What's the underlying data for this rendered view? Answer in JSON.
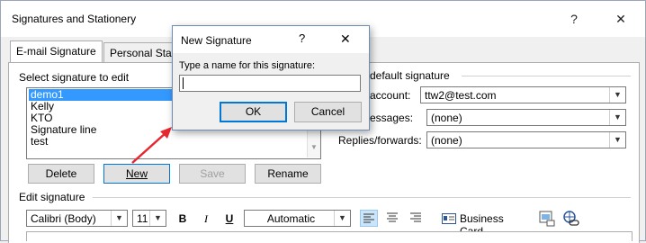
{
  "window": {
    "title": "Signatures and Stationery",
    "help": "?",
    "close": "✕",
    "tabs": [
      {
        "label": "E-mail Signature"
      },
      {
        "label": "Personal Stati"
      }
    ]
  },
  "select_section": {
    "label": "Select signature to edit",
    "items": [
      "demo1",
      "Kelly",
      "KTO",
      "Signature line",
      "test"
    ],
    "selected": "demo1",
    "buttons": {
      "delete": "Delete",
      "new": "New",
      "save": "Save",
      "rename": "Rename"
    }
  },
  "default_section": {
    "label": "default signature",
    "account_label": "account:",
    "account_value": "ttw2@test.com",
    "new_messages_label": "essages:",
    "new_messages_value": "(none)",
    "replies_label": "Replies/forwards:",
    "replies_value": "(none)"
  },
  "edit_section": {
    "label": "Edit signature",
    "font": "Calibri (Body)",
    "size": "11",
    "bold": "B",
    "italic": "I",
    "underline": "U",
    "color": "Automatic",
    "business_card": "Business Card"
  },
  "dialog": {
    "title": "New Signature",
    "help": "?",
    "close": "✕",
    "prompt": "Type a name for this signature:",
    "input_value": "",
    "ok": "OK",
    "cancel": "Cancel"
  },
  "colors": {
    "selection": "#3399ff",
    "arrow": "#e8262d",
    "focus_border": "#0078d7"
  }
}
